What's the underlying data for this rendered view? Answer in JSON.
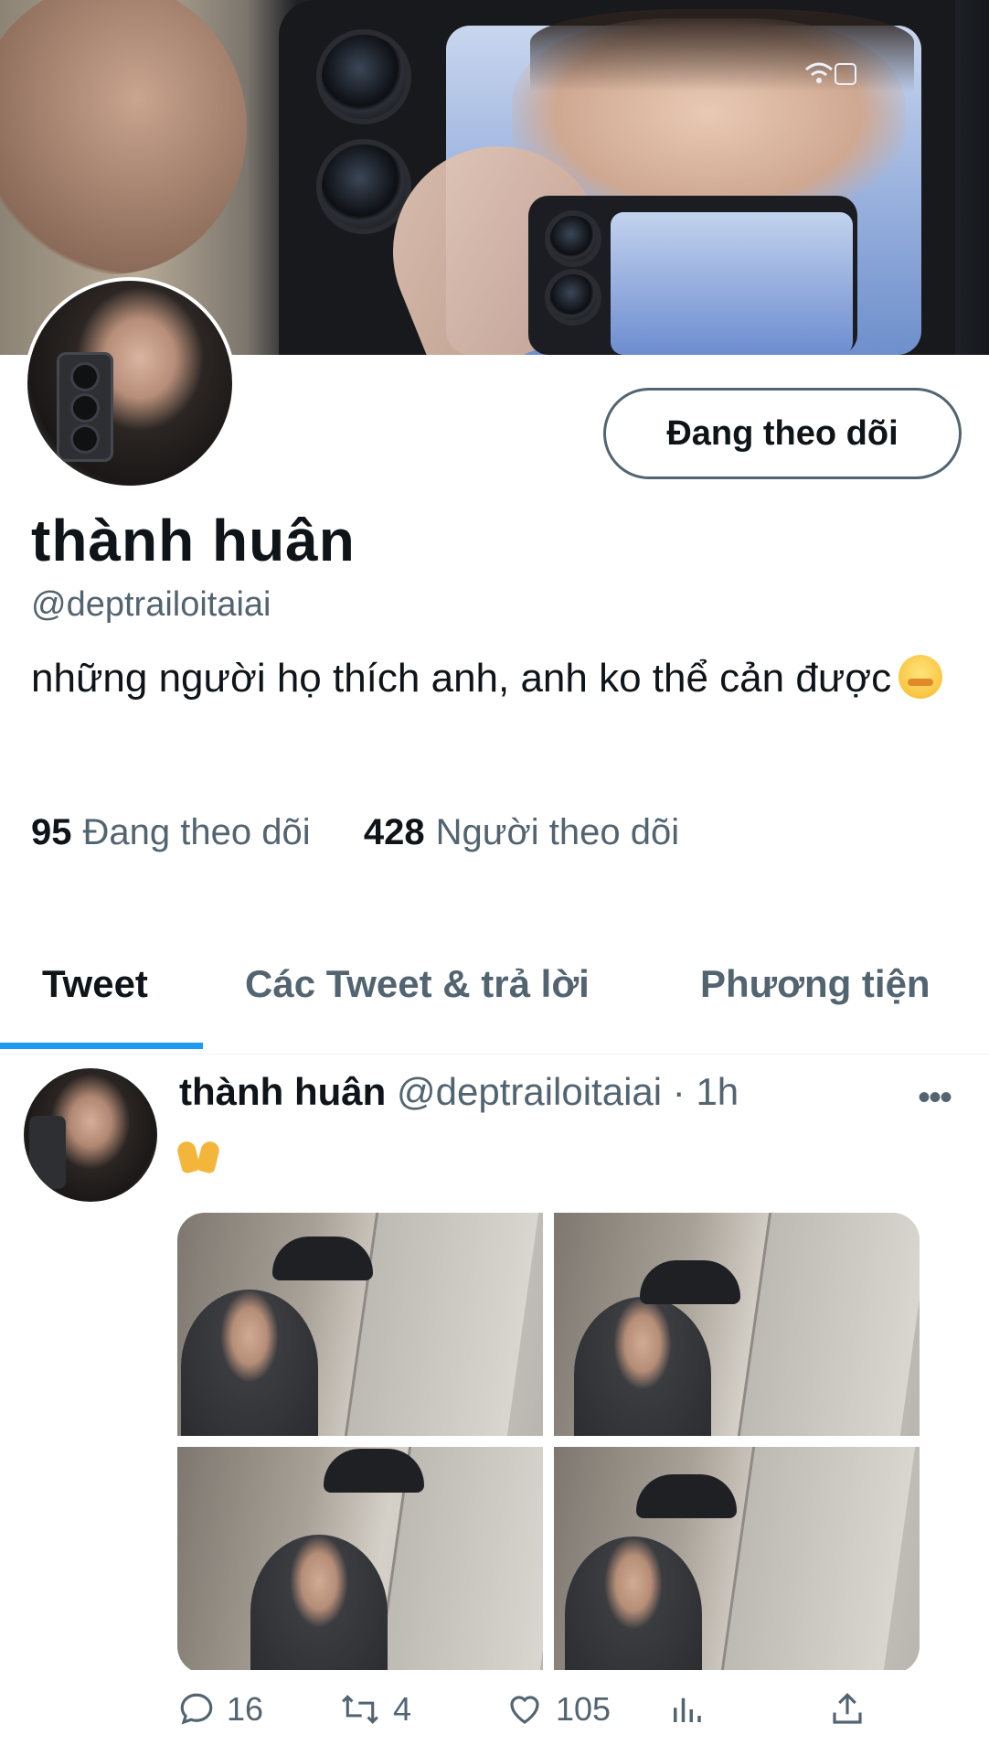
{
  "profile": {
    "display_name": "thành huân",
    "handle": "@deptrailoitaiai",
    "bio": "những người họ thích anh, anh ko thể cản được",
    "follow_button_label": "Đang theo dõi",
    "following_count": "95",
    "following_label": "Đang theo dõi",
    "followers_count": "428",
    "followers_label": "Người theo dõi"
  },
  "tabs": [
    {
      "label": "Tweet",
      "active": true
    },
    {
      "label": "Các Tweet & trả lời",
      "active": false
    },
    {
      "label": "Phương tiện",
      "active": false
    }
  ],
  "tweet": {
    "author_name": "thành huân",
    "author_handle": "@deptrailoitaiai",
    "separator": "·",
    "time": "1h",
    "text_emoji": "raising-hands",
    "photo_count": 4,
    "replies": "16",
    "retweets": "4",
    "likes": "105"
  },
  "colors": {
    "accent": "#1d9bf0",
    "secondary_text": "#536471",
    "primary_text": "#0f1419"
  }
}
